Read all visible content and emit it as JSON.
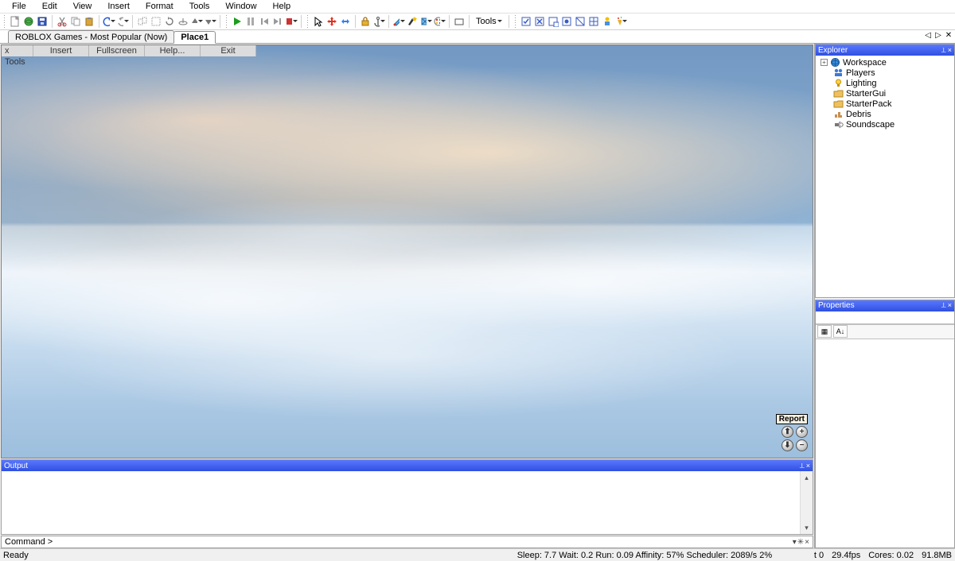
{
  "menu": [
    "File",
    "Edit",
    "View",
    "Insert",
    "Format",
    "Tools",
    "Window",
    "Help"
  ],
  "toolbar_text": "Tools",
  "tabs": [
    {
      "label": "ROBLOX Games - Most Popular (Now)",
      "active": false
    },
    {
      "label": "Place1",
      "active": true
    }
  ],
  "tab_nav": {
    "left": "◁",
    "right": "▷",
    "close": "✕"
  },
  "view_menu": [
    "x Tools",
    "Insert",
    "Fullscreen",
    "Help...",
    "Exit"
  ],
  "hud": {
    "report": "Report",
    "up": "⬆",
    "zoom_in": "+",
    "down": "⬇",
    "zoom_out": "−"
  },
  "output": {
    "title": "Output",
    "pin": "⟂",
    "close": "×"
  },
  "command": {
    "prompt": "Command >",
    "drop": "▾",
    "gear": "✳",
    "close": "×"
  },
  "explorer": {
    "title": "Explorer",
    "pin": "⟂",
    "close": "×",
    "root": "Workspace",
    "children": [
      "Players",
      "Lighting",
      "StarterGui",
      "StarterPack",
      "Debris",
      "Soundscape"
    ]
  },
  "properties": {
    "title": "Properties",
    "pin": "⟂",
    "close": "×",
    "cat": "▦",
    "sort": "A↓"
  },
  "status": {
    "ready": "Ready",
    "perf": "Sleep: 7.7 Wait: 0.2 Run: 0.09 Affinity: 57% Scheduler: 2089/s 2%",
    "t": "t 0",
    "fps": "29.4fps",
    "cores": "Cores: 0.02",
    "mem": "91.8MB"
  },
  "icon_colors": {
    "globe": "#2b7fff",
    "players": "#3b78d8",
    "light": "#f0a020",
    "folder": "#d9a43a",
    "debris": "#c99050",
    "sound": "#777"
  }
}
